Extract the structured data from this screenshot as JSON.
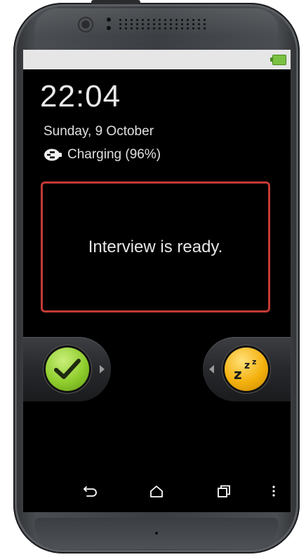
{
  "lock_screen": {
    "time": "22:04",
    "date": "Sunday, 9 October",
    "charging_text": "Charging (96%)"
  },
  "notification": {
    "message": "Interview is ready."
  },
  "icons": {
    "battery": "battery-icon",
    "charging": "plug-icon",
    "accept": "checkmark-icon",
    "snooze": "snooze-zzz-icon",
    "back": "back-icon",
    "home": "home-icon",
    "recents": "recents-icon",
    "menu": "overflow-menu-icon"
  },
  "colors": {
    "notification_border": "#c33a35",
    "accept": "#8fcd2d",
    "snooze": "#f4b10d",
    "battery": "#7bc143"
  },
  "snooze_glyphs": [
    "z",
    "z",
    "z"
  ]
}
